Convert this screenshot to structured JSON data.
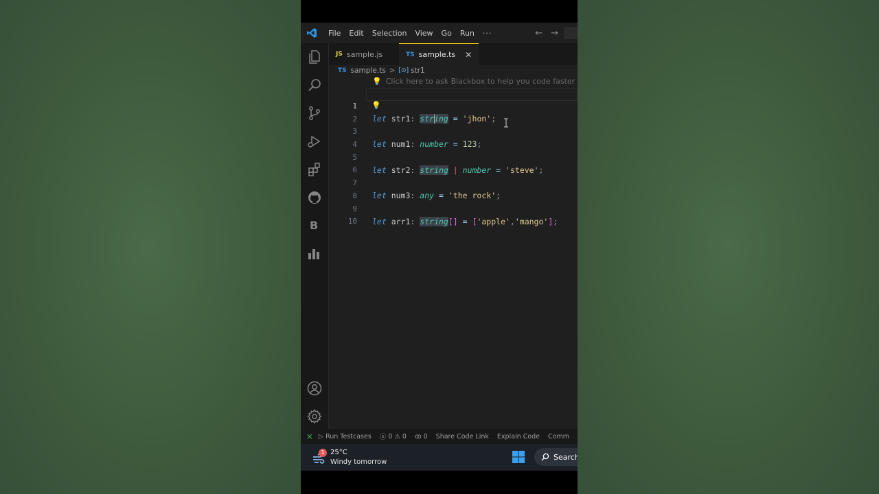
{
  "menubar": {
    "items": [
      "File",
      "Edit",
      "Selection",
      "View",
      "Go",
      "Run"
    ],
    "more": "···"
  },
  "tabs": [
    {
      "lang": "JS",
      "label": "sample.js",
      "active": false
    },
    {
      "lang": "TS",
      "label": "sample.ts",
      "active": true,
      "close": "✕"
    }
  ],
  "breadcrumb": {
    "lang": "TS",
    "file": "sample.ts",
    "separator": ">",
    "symbol_icon": "[⊙]",
    "symbol": "str1"
  },
  "editor": {
    "hint": "Click here to ask Blackbox to help you code faster",
    "line_numbers": [
      "1",
      "2",
      "3",
      "4",
      "5",
      "6",
      "7",
      "8",
      "9",
      "10"
    ],
    "current_line": 1,
    "lines": [
      {
        "kw": "let",
        "name": "str1",
        "colon": ":",
        "type": "string",
        "type_a": "str",
        "type_b": "ing",
        "eq": "=",
        "value": "'jhon'",
        "semi": ";"
      },
      {},
      {
        "kw": "let",
        "name": "num1",
        "colon": ":",
        "type": "number",
        "eq": "=",
        "value": "123",
        "semi": ";"
      },
      {},
      {
        "kw": "let",
        "name": "str2",
        "colon": ":",
        "type": "string",
        "pipe": "|",
        "type2": "number",
        "eq": "=",
        "value": "'steve'",
        "semi": ";"
      },
      {},
      {
        "kw": "let",
        "name": "num3",
        "colon": ":",
        "type": "any",
        "eq": "=",
        "value": "'the rock'",
        "semi": ";"
      },
      {},
      {
        "kw": "let",
        "name": "arr1",
        "colon": ":",
        "type": "string",
        "brackets": "[]",
        "eq": "=",
        "open": "[",
        "v1": "'apple'",
        "comma": ",",
        "v2": "'mango'",
        "close": "]",
        "semi": ";"
      }
    ]
  },
  "statusbar": {
    "run_testcases": "Run Testcases",
    "errors": "0",
    "warnings": "0",
    "ports": "0",
    "share": "Share Code Link",
    "explain": "Explain Code",
    "comment": "Comm"
  },
  "taskbar": {
    "badge": "1",
    "temperature": "25°C",
    "forecast": "Windy tomorrow",
    "search": "Search"
  },
  "colors": {
    "accent_tab": "#f0c419",
    "keyword": "#569cd6",
    "type": "#4ec9b0",
    "string": "#e0c98f"
  }
}
